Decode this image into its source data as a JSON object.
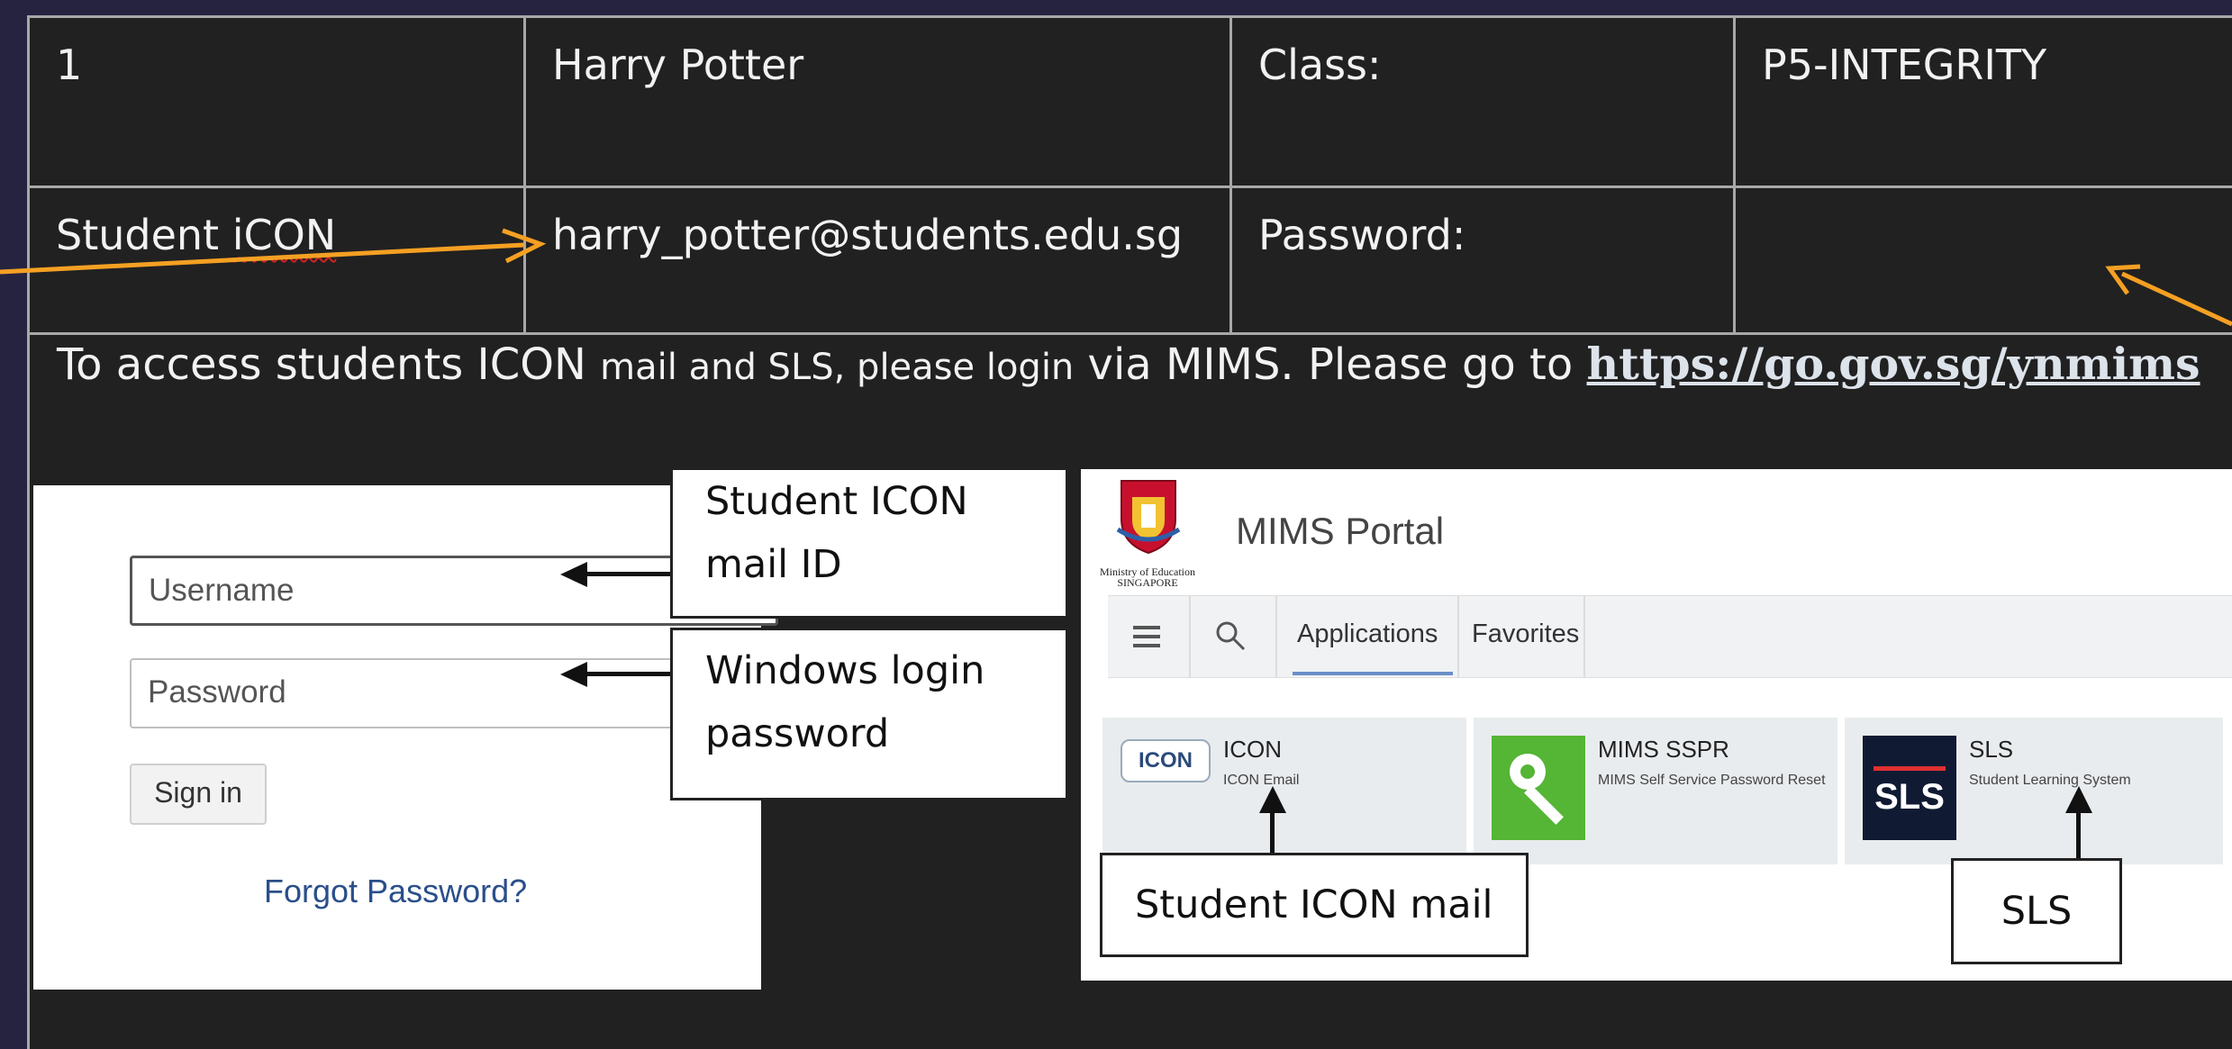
{
  "table": {
    "row1": {
      "no": "1",
      "name": "Harry Potter",
      "class_label": "Class:",
      "class_value": "P5-INTEGRITY"
    },
    "row2": {
      "label": "Student iCON",
      "email": "harry_potter@students.edu.sg",
      "password_label": "Password:",
      "password_value": ""
    }
  },
  "instruction": {
    "part1": "To access students ICON ",
    "part2": "mail and  SLS, please login",
    "part3": " via MIMS. Please go to ",
    "link": "https://go.gov.sg/ynmims"
  },
  "login": {
    "username_placeholder": "Username",
    "password_placeholder": "Password",
    "signin_label": "Sign in",
    "forgot_label": "Forgot Password?"
  },
  "callouts": {
    "username": "Student ICON\nmail ID",
    "password": "Windows login\npassword",
    "icon_mail": "Student ICON mail",
    "sls": "SLS"
  },
  "mims": {
    "ministry_label": "Ministry of Education\nSINGAPORE",
    "title": "MIMS Portal",
    "tabs": [
      "Applications",
      "Favorites"
    ],
    "tiles": [
      {
        "name": "ICON",
        "sub": "ICON Email",
        "logo": "ICON"
      },
      {
        "name": "MIMS SSPR",
        "sub": "MIMS Self Service Password Reset",
        "icon": "key-icon"
      },
      {
        "name": "SLS",
        "sub": "Student Learning System",
        "logo": "SLS"
      }
    ]
  },
  "colors": {
    "annotation_arrow": "#f5a023",
    "background": "#212121",
    "frame": "#252340"
  }
}
